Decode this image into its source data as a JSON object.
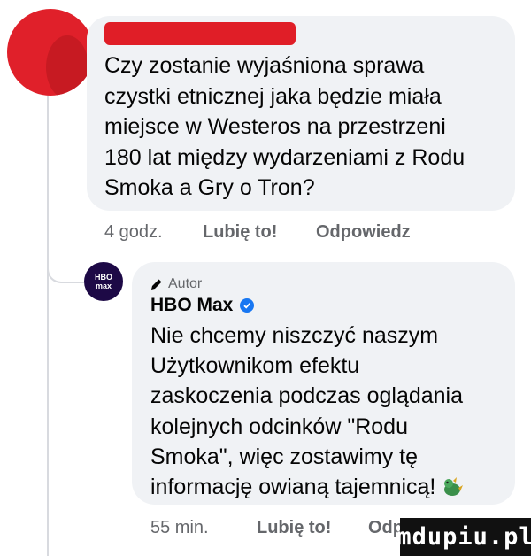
{
  "thread": {
    "comment1": {
      "text": "Czy zostanie wyjaśniona sprawa\nczystki etnicznej jaka będzie miała\nmiejsce w Westeros na przestrzeni\n180 lat między wydarzeniami z Rodu\nSmoka a Gry o Tron?",
      "time": "4 godz.",
      "like_label": "Lubię to!",
      "reply_label": "Odpowiedz"
    },
    "reply": {
      "author_badge": "Autor",
      "avatar_text_top": "HBO",
      "avatar_text_bottom": "max",
      "name": "HBO Max",
      "text": "Nie chcemy niszczyć naszym\nUżytkownikom efektu\nzaskoczenia podczas oglądania\nkolejnych odcinków \"Rodu\nSmoka\", więc zostawimy tę\ninformację owianą tajemnicą!",
      "emoji": "dragon-emoji",
      "time": "55 min.",
      "like_label": "Lubię to!",
      "reply_label": "Odpowiedz"
    }
  },
  "watermark": "mdupiu.pl",
  "colors": {
    "bubble_bg": "#f0f2f5",
    "meta_text": "#65676b",
    "verified_blue": "#1877f2",
    "redaction_red": "#e01e27"
  }
}
